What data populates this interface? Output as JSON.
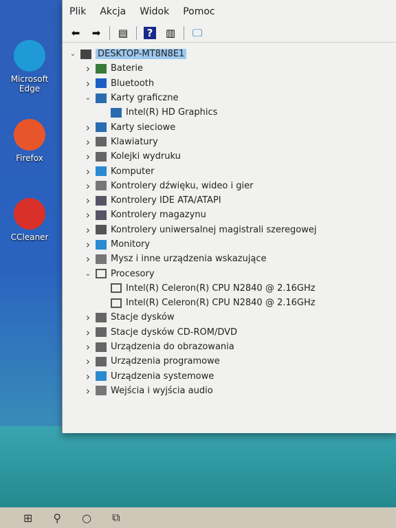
{
  "desktop": {
    "icons": [
      {
        "label": "Microsoft Edge",
        "icon": "edge-icon",
        "color": "#1f9ad6"
      },
      {
        "label": "Firefox",
        "icon": "firefox-icon",
        "color": "#e8552a"
      },
      {
        "label": "CCleaner",
        "icon": "ccleaner-icon",
        "color": "#d9302a"
      }
    ]
  },
  "menu": [
    "Plik",
    "Akcja",
    "Widok",
    "Pomoc"
  ],
  "toolbar": [
    {
      "icon": "back-arrow-icon",
      "glyph": "⬅"
    },
    {
      "icon": "forward-arrow-icon",
      "glyph": "➡"
    },
    {
      "icon": "properties-icon",
      "glyph": "▤"
    },
    {
      "icon": "help-icon",
      "glyph": "?"
    },
    {
      "icon": "update-driver-icon",
      "glyph": "▥"
    },
    {
      "icon": "scan-hardware-icon",
      "glyph": "🖵"
    }
  ],
  "tree": [
    {
      "label": "DESKTOP-MT8N8E1",
      "level": 0,
      "state": "expanded",
      "color": "#444"
    },
    {
      "label": "Baterie",
      "level": 1,
      "state": "collapsed",
      "color": "#3a7a3a"
    },
    {
      "label": "Bluetooth",
      "level": 1,
      "state": "collapsed",
      "color": "#1d5fc4"
    },
    {
      "label": "Karty graficzne",
      "level": 1,
      "state": "expanded",
      "color": "#2b6cb0"
    },
    {
      "label": "Intel(R) HD Graphics",
      "level": 2,
      "state": "leaf",
      "color": "#2b6cb0"
    },
    {
      "label": "Karty sieciowe",
      "level": 1,
      "state": "collapsed",
      "color": "#2b6cb0"
    },
    {
      "label": "Klawiatury",
      "level": 1,
      "state": "collapsed",
      "color": "#666"
    },
    {
      "label": "Kolejki wydruku",
      "level": 1,
      "state": "collapsed",
      "color": "#666"
    },
    {
      "label": "Komputer",
      "level": 1,
      "state": "collapsed",
      "color": "#2b8ad0"
    },
    {
      "label": "Kontrolery dźwięku, wideo i gier",
      "level": 1,
      "state": "collapsed",
      "color": "#777"
    },
    {
      "label": "Kontrolery IDE ATA/ATAPI",
      "level": 1,
      "state": "collapsed",
      "color": "#556"
    },
    {
      "label": "Kontrolery magazynu",
      "level": 1,
      "state": "collapsed",
      "color": "#556"
    },
    {
      "label": "Kontrolery uniwersalnej magistrali szeregowej",
      "level": 1,
      "state": "collapsed",
      "color": "#555"
    },
    {
      "label": "Monitory",
      "level": 1,
      "state": "collapsed",
      "color": "#2b8ad0"
    },
    {
      "label": "Mysz i inne urządzenia wskazujące",
      "level": 1,
      "state": "collapsed",
      "color": "#777"
    },
    {
      "label": "Procesory",
      "level": 1,
      "state": "expanded",
      "color": "#555"
    },
    {
      "label": "Intel(R) Celeron(R) CPU  N2840  @ 2.16GHz",
      "level": 2,
      "state": "leaf",
      "color": "#555"
    },
    {
      "label": "Intel(R) Celeron(R) CPU  N2840  @ 2.16GHz",
      "level": 2,
      "state": "leaf",
      "color": "#555"
    },
    {
      "label": "Stacje dysków",
      "level": 1,
      "state": "collapsed",
      "color": "#666"
    },
    {
      "label": "Stacje dysków CD-ROM/DVD",
      "level": 1,
      "state": "collapsed",
      "color": "#666"
    },
    {
      "label": "Urządzenia do obrazowania",
      "level": 1,
      "state": "collapsed",
      "color": "#666"
    },
    {
      "label": "Urządzenia programowe",
      "level": 1,
      "state": "collapsed",
      "color": "#666"
    },
    {
      "label": "Urządzenia systemowe",
      "level": 1,
      "state": "collapsed",
      "color": "#2b8ad0"
    },
    {
      "label": "Wejścia i wyjścia audio",
      "level": 1,
      "state": "collapsed",
      "color": "#777"
    }
  ],
  "taskbar": [
    {
      "icon": "windows-start-icon",
      "glyph": "⊞"
    },
    {
      "icon": "search-icon",
      "glyph": "⚲"
    },
    {
      "icon": "cortana-icon",
      "glyph": "○"
    },
    {
      "icon": "task-view-icon",
      "glyph": "⧉"
    }
  ]
}
